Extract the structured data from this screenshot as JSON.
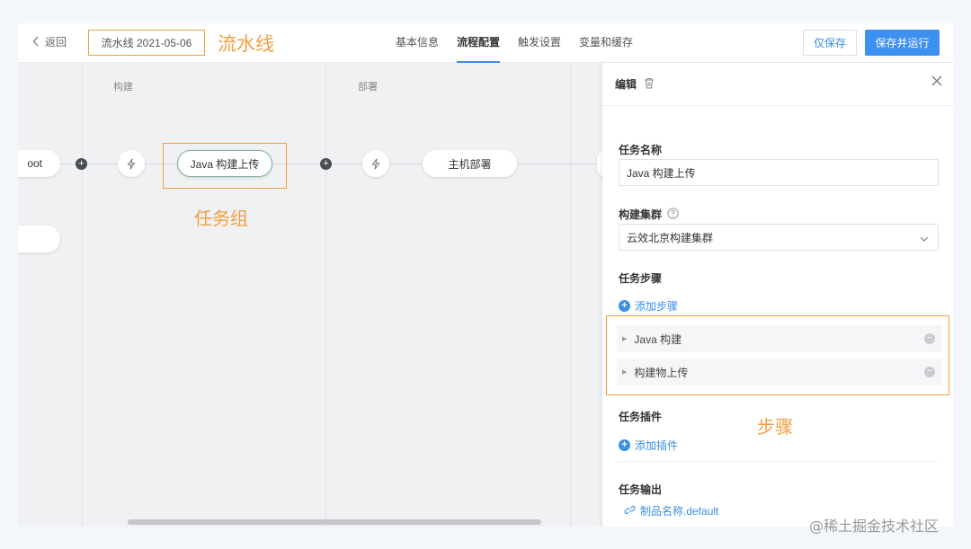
{
  "header": {
    "back_label": "返回",
    "pipeline_name": "流水线 2021-05-06",
    "tabs": [
      {
        "label": "基本信息",
        "active": false
      },
      {
        "label": "流程配置",
        "active": true
      },
      {
        "label": "触发设置",
        "active": false
      },
      {
        "label": "变量和缓存",
        "active": false
      }
    ],
    "save_label": "仅保存",
    "save_run_label": "保存并运行"
  },
  "annotations": {
    "pipeline": "流水线",
    "task_group": "任务组",
    "steps": "步骤"
  },
  "canvas": {
    "stages": [
      {
        "title": "构建"
      },
      {
        "title": "部署"
      }
    ],
    "left_node_partial": "oot",
    "build_job": "Java 构建上传",
    "deploy_job": "主机部署"
  },
  "panel": {
    "title": "编辑",
    "task_name_label": "任务名称",
    "task_name_value": "Java 构建上传",
    "cluster_label": "构建集群",
    "cluster_value": "云效北京构建集群",
    "steps_label": "任务步骤",
    "add_step_label": "添加步骤",
    "steps": [
      {
        "label": "Java 构建"
      },
      {
        "label": "构建物上传"
      }
    ],
    "plugins_label": "任务插件",
    "add_plugin_label": "添加插件",
    "output_label": "任务输出",
    "output_value": "制品名称.default"
  },
  "watermark": "@稀土掘金技术社区",
  "colors": {
    "accent": "#3d8ff0",
    "annotation": "#f0a040"
  }
}
